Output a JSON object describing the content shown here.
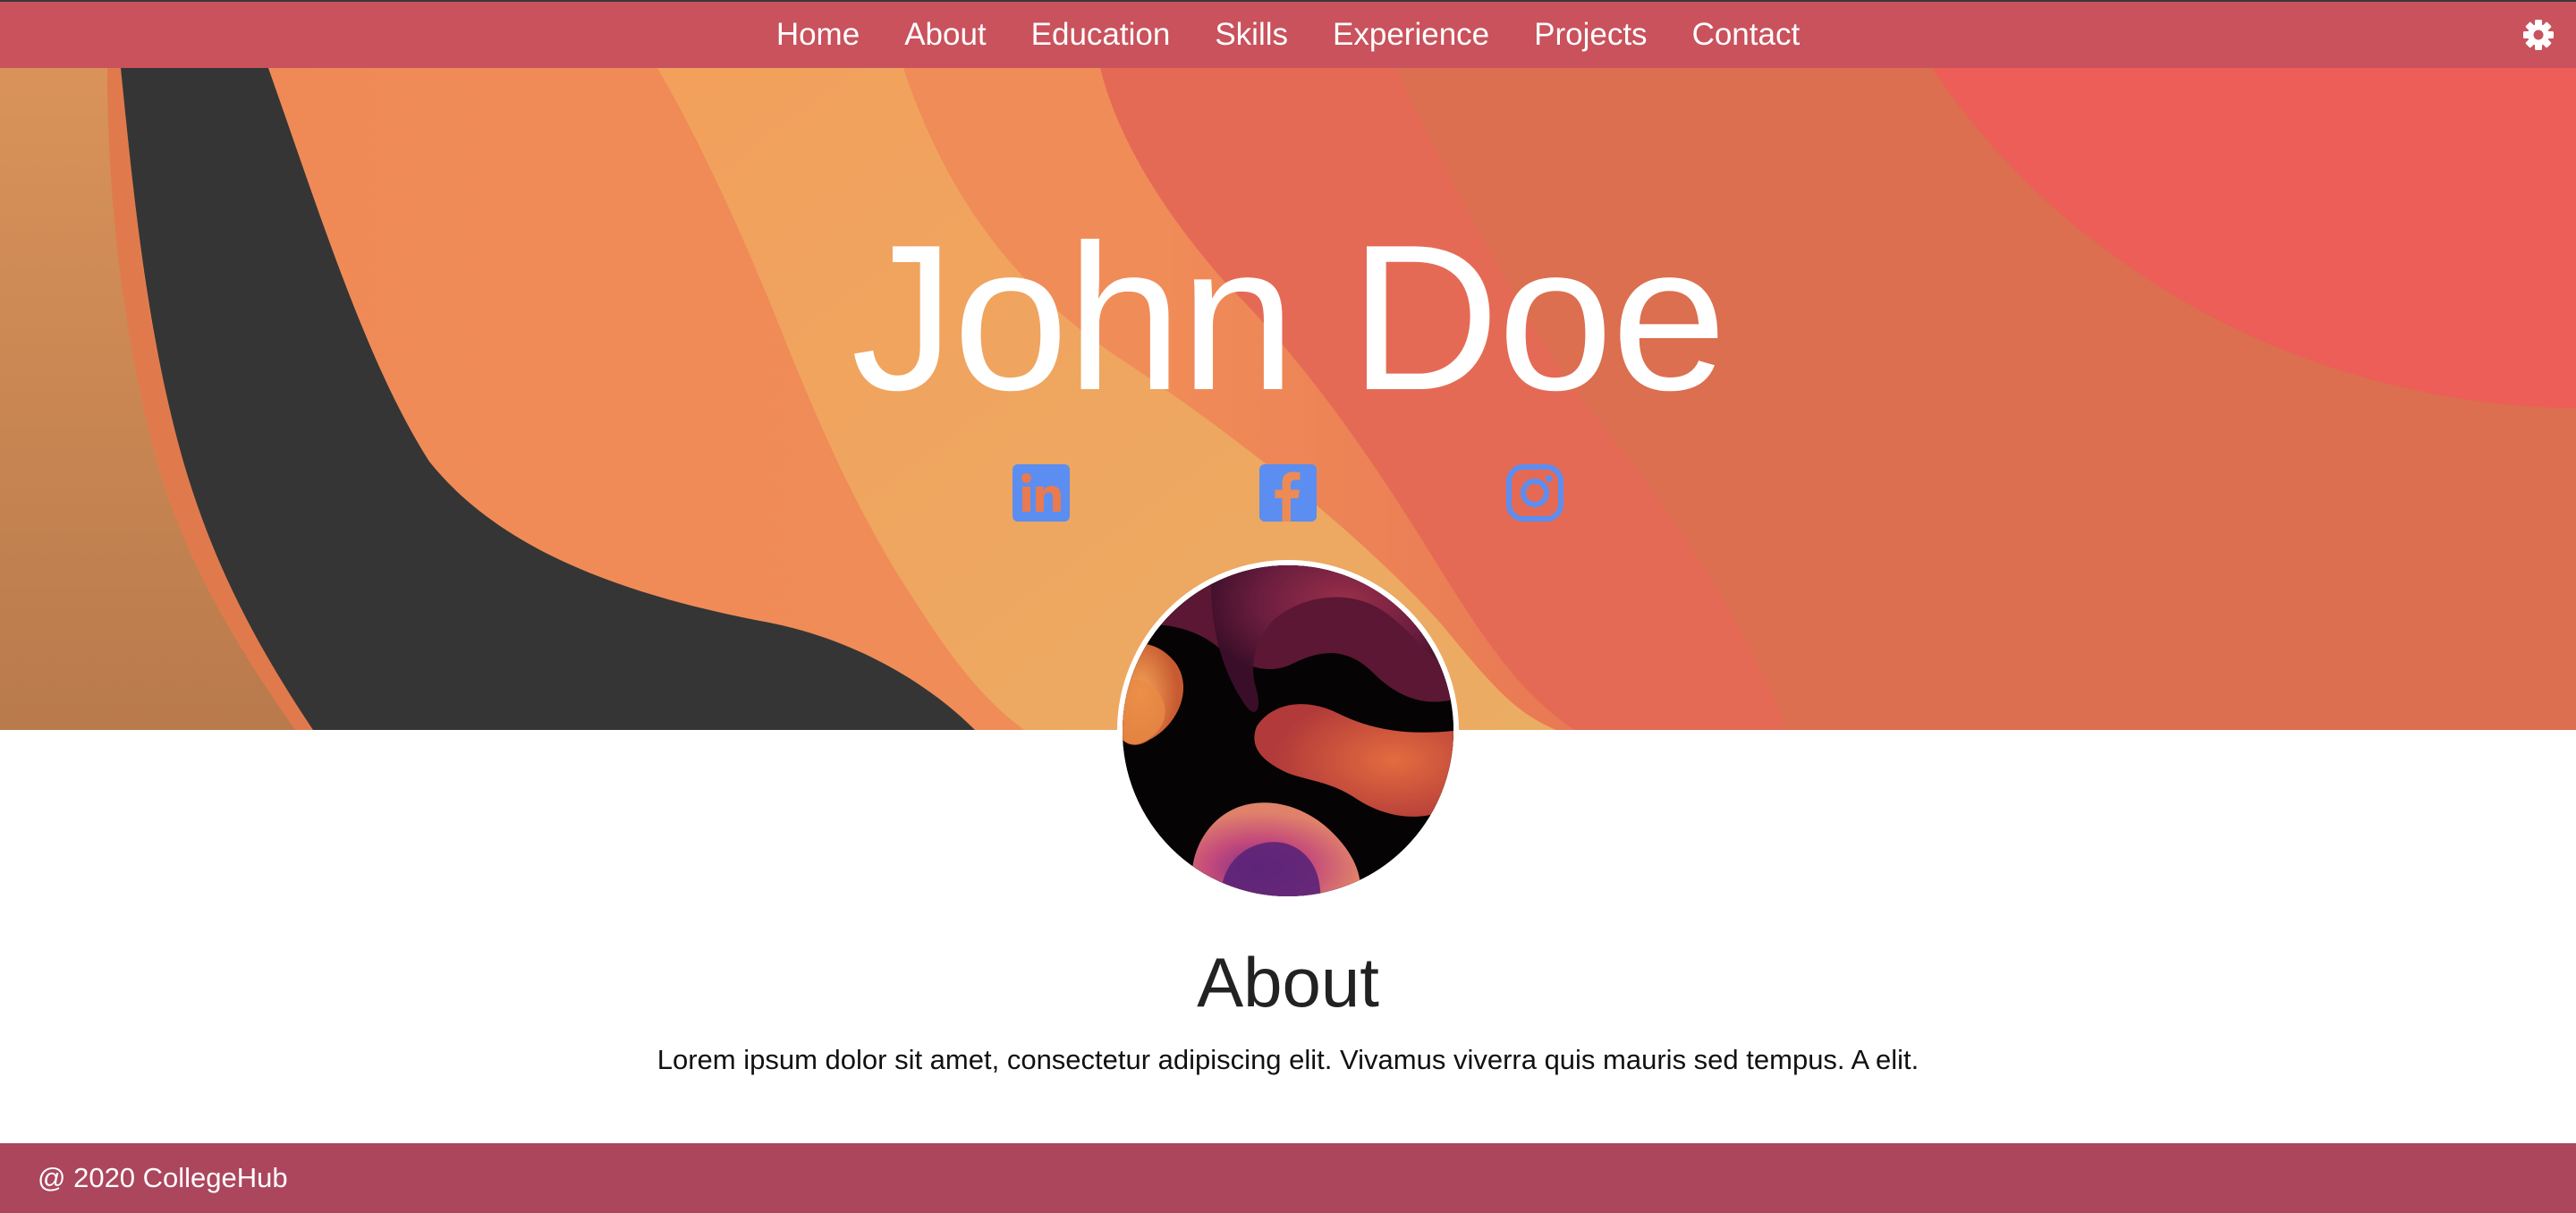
{
  "nav": {
    "items": [
      {
        "label": "Home"
      },
      {
        "label": "About"
      },
      {
        "label": "Education"
      },
      {
        "label": "Skills"
      },
      {
        "label": "Experience"
      },
      {
        "label": "Projects"
      },
      {
        "label": "Contact"
      }
    ],
    "settings_icon": "gear-icon"
  },
  "hero": {
    "name": "John Doe",
    "social": [
      {
        "icon": "linkedin-icon"
      },
      {
        "icon": "facebook-icon"
      },
      {
        "icon": "instagram-icon"
      }
    ]
  },
  "about": {
    "heading": "About",
    "text": "Lorem ipsum dolor sit amet, consectetur adipiscing elit. Vivamus viverra quis mauris sed tempus. A elit."
  },
  "footer": {
    "text": "@ 2020 CollegeHub"
  },
  "colors": {
    "navbar": "#c9525c",
    "footer": "#ab465d",
    "social_icon": "#5b8ef0",
    "hero_text": "#ffffff"
  }
}
